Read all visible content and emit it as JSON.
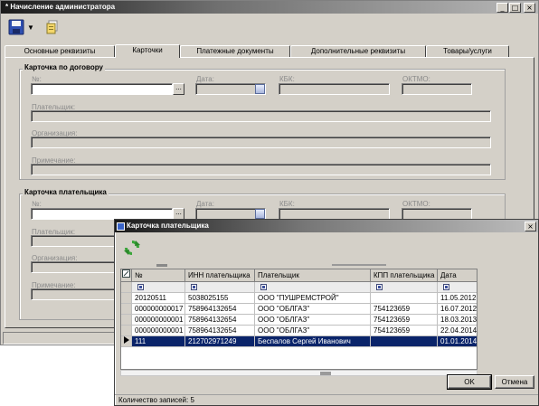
{
  "main_window": {
    "title": "* Начисление администратора",
    "controls": {
      "minimize": "_",
      "maximize": "□",
      "close": "×"
    }
  },
  "toolbar": {
    "save_dropdown": "▼"
  },
  "tabs": [
    {
      "label": "Основные реквизиты"
    },
    {
      "label": "Карточки"
    },
    {
      "label": "Платежные документы"
    },
    {
      "label": "Дополнительные реквизиты"
    },
    {
      "label": "Товары/услуги"
    }
  ],
  "active_tab": "Карточки",
  "contract_card": {
    "legend": "Карточка по договору",
    "number_label": "№:",
    "number_value": "",
    "ellipsis": "...",
    "date_label": "Дата:",
    "kbk_label": "КБК:",
    "oktmo_label": "ОКТМО:",
    "payer_label": "Плательщик:",
    "org_label": "Организация:",
    "note_label": "Примечание:"
  },
  "payer_card": {
    "legend": "Карточка плательщика",
    "number_label": "№:",
    "number_value": "",
    "ellipsis": "...",
    "date_label": "Дата:",
    "kbk_label": "КБК:",
    "oktmo_label": "ОКТМО:",
    "payer_label": "Плательщик:",
    "org_label": "Организация:",
    "note_label": "Примечание:"
  },
  "dialog": {
    "title": "Карточка плательщика",
    "close": "×",
    "columns": [
      "№",
      "ИНН плательщика",
      "Плательщик",
      "КПП плательщика",
      "Дата"
    ],
    "rows": [
      {
        "num": "20120511",
        "inn": "5038025155",
        "payer": "ООО \"ПУШРЕМСТРОЙ\"",
        "kpp": "",
        "date": "11.05.2012"
      },
      {
        "num": "000000000017",
        "inn": "758964132654",
        "payer": "ООО \"ОБЛГАЗ\"",
        "kpp": "754123659",
        "date": "16.07.2012"
      },
      {
        "num": "000000000001",
        "inn": "758964132654",
        "payer": "ООО \"ОБЛГАЗ\"",
        "kpp": "754123659",
        "date": "18.03.2013"
      },
      {
        "num": "000000000001",
        "inn": "758964132654",
        "payer": "ООО \"ОБЛГАЗ\"",
        "kpp": "754123659",
        "date": "22.04.2014"
      },
      {
        "num": "111",
        "inn": "212702971249",
        "payer": "Беспалов Сергей Иванович",
        "kpp": "",
        "date": "01.01.2014"
      }
    ],
    "selected_row": 4,
    "ok_label": "OK",
    "cancel_label": "Отмена",
    "status": "Количество записей: 5"
  }
}
